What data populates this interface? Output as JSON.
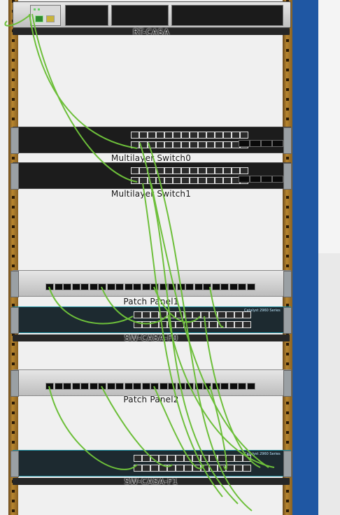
{
  "rack": {
    "devices": [
      {
        "label": "RT-CASA"
      },
      {
        "label": "Multilayer Switch0"
      },
      {
        "label": "Multilayer Switch1"
      },
      {
        "label": "Patch Panel1"
      },
      {
        "label": "SW-CASA-F0"
      },
      {
        "label": "Patch Panel2"
      },
      {
        "label": "SW-CASA-F1"
      }
    ],
    "catalyst_badge": "Catalyst 2960 Series"
  },
  "colors": {
    "cable": "#6dbf3a",
    "rack_rail": "#b8862e",
    "background_right": "#1f57a3"
  }
}
